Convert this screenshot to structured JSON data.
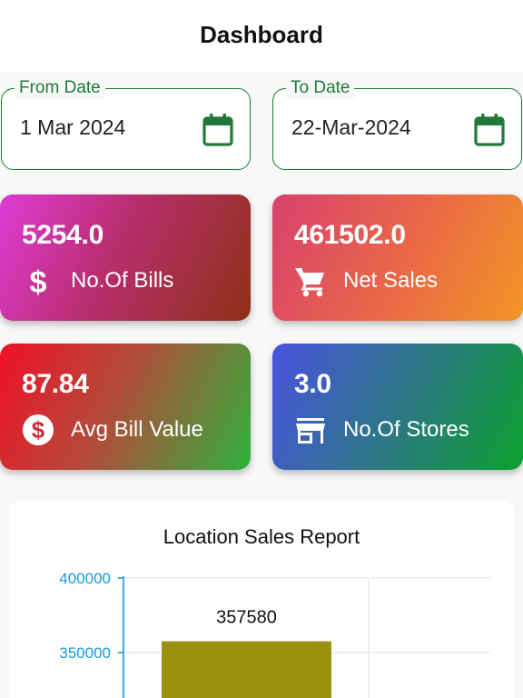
{
  "header": {
    "title": "Dashboard"
  },
  "filters": {
    "from": {
      "label": "From Date",
      "value": "1 Mar 2024",
      "icon": "calendar-icon"
    },
    "to": {
      "label": "To Date",
      "value": "22-Mar-2024",
      "icon": "calendar-icon"
    }
  },
  "cards": {
    "bills": {
      "value": "5254.0",
      "label": "No.Of Bills",
      "icon": "dollar-icon"
    },
    "sales": {
      "value": "461502.0",
      "label": "Net Sales",
      "icon": "cart-icon"
    },
    "avg": {
      "value": "87.84",
      "label": "Avg Bill Value",
      "icon": "dollar-circle-icon"
    },
    "stores": {
      "value": "3.0",
      "label": "No.Of Stores",
      "icon": "store-icon"
    }
  },
  "colors": {
    "accent": "#1f7a3a",
    "axis": "#1a9bd6",
    "bar": "#9b9210"
  },
  "chart_data": {
    "type": "bar",
    "title": "Location Sales Report",
    "categories": [
      ""
    ],
    "values": [
      357580
    ],
    "data_labels": [
      "357580"
    ],
    "yticks": [
      {
        "value": 400000,
        "label": "400000"
      },
      {
        "value": 350000,
        "label": "350000"
      }
    ],
    "ylim_visible": [
      337000,
      400000
    ],
    "grid": true
  }
}
